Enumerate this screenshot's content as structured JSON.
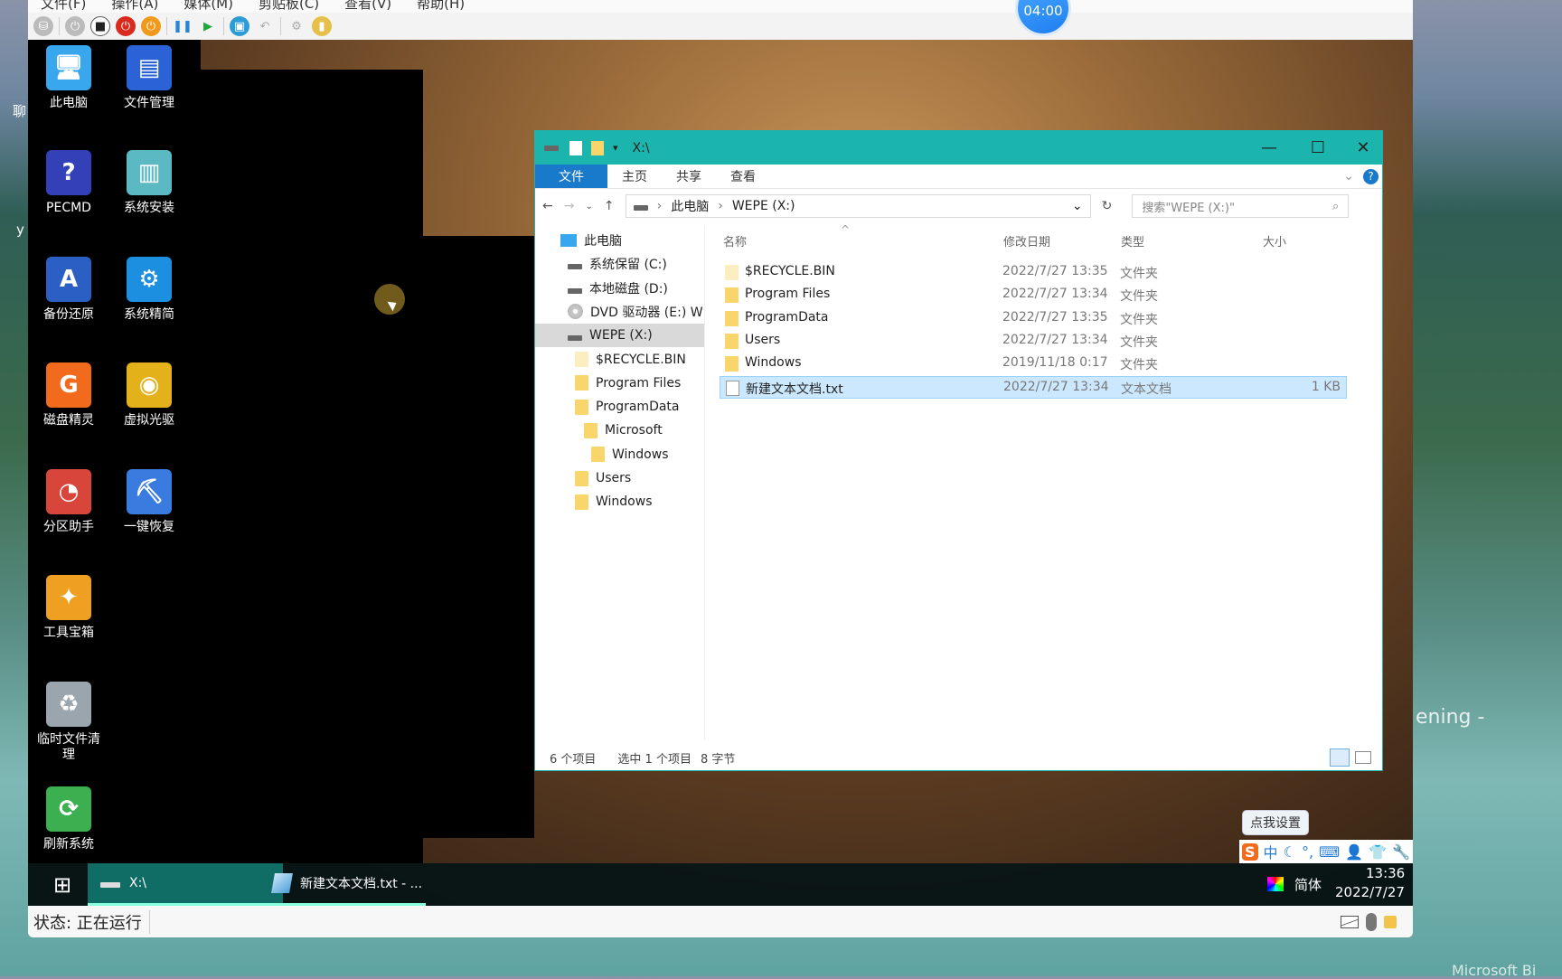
{
  "host": {
    "left_fragments": [
      "聊",
      "y"
    ],
    "right_text": "ening -",
    "watermark": "Microsoft Bi"
  },
  "vm": {
    "menu": [
      "文件(F)",
      "操作(A)",
      "媒体(M)",
      "剪贴板(C)",
      "查看(V)",
      "帮助(H)"
    ],
    "toolbar_icons": [
      "network-icon",
      "power-gray-icon",
      "stop-icon",
      "power-red-icon",
      "power-orange-icon",
      "pause-icon",
      "play-icon",
      "snapshot-icon",
      "undo-icon",
      "settings-icon",
      "folder-share-icon"
    ],
    "timer": "04:00",
    "status": "状态: 正在运行"
  },
  "desktop": {
    "icons": [
      {
        "label": "此电脑",
        "icon": "computer-icon",
        "color": "#39a7ee"
      },
      {
        "label": "文件管理",
        "icon": "floppy-icon",
        "color": "#2b63d6"
      },
      {
        "label": "PECMD",
        "icon": "help-icon",
        "color": "#3440b8"
      },
      {
        "label": "系统安装",
        "icon": "install-icon",
        "color": "#5bb9c4"
      },
      {
        "label": "备份还原",
        "icon": "backup-icon",
        "color": "#2c5fc4"
      },
      {
        "label": "系统精简",
        "icon": "gears-icon",
        "color": "#1d8fe0"
      },
      {
        "label": "磁盘精灵",
        "icon": "diskgenius-icon",
        "color": "#f26a1b"
      },
      {
        "label": "虚拟光驱",
        "icon": "cd-icon",
        "color": "#e3b21a"
      },
      {
        "label": "分区助手",
        "icon": "partition-icon",
        "color": "#d8453a"
      },
      {
        "label": "一键恢复",
        "icon": "restore-icon",
        "color": "#3a7be0"
      },
      {
        "label": "工具宝箱",
        "icon": "toolbox-icon",
        "color": "#f0a020"
      },
      {
        "label": "临时文件清理",
        "icon": "recycle-icon",
        "color": "#9aa5ad"
      },
      {
        "label": "刷新系统",
        "icon": "refresh-icon",
        "color": "#3cb050"
      }
    ]
  },
  "explorer": {
    "title": "X:\\",
    "accent": "#1bb5ad",
    "ribbon_tabs": [
      "文件",
      "主页",
      "共享",
      "查看"
    ],
    "breadcrumb": [
      "此电脑",
      "WEPE (X:)"
    ],
    "search_placeholder": "搜索\"WEPE (X:)\"",
    "nav": [
      {
        "label": "此电脑",
        "type": "pc"
      },
      {
        "label": "系统保留 (C:)",
        "type": "drive"
      },
      {
        "label": "本地磁盘 (D:)",
        "type": "drive"
      },
      {
        "label": "DVD 驱动器 (E:) W",
        "type": "dvd"
      },
      {
        "label": "WEPE (X:)",
        "type": "drive",
        "selected": true
      },
      {
        "label": "$RECYCLE.BIN",
        "type": "folder-pale"
      },
      {
        "label": "Program Files",
        "type": "folder"
      },
      {
        "label": "ProgramData",
        "type": "folder"
      },
      {
        "label": "Microsoft",
        "type": "folder"
      },
      {
        "label": "Windows",
        "type": "folder"
      },
      {
        "label": "Users",
        "type": "folder"
      },
      {
        "label": "Windows",
        "type": "folder"
      }
    ],
    "columns": [
      "名称",
      "修改日期",
      "类型",
      "大小"
    ],
    "files": [
      {
        "name": "$RECYCLE.BIN",
        "date": "2022/7/27 13:35",
        "type": "文件夹",
        "size": "",
        "kind": "folder-pale"
      },
      {
        "name": "Program Files",
        "date": "2022/7/27 13:34",
        "type": "文件夹",
        "size": "",
        "kind": "folder"
      },
      {
        "name": "ProgramData",
        "date": "2022/7/27 13:35",
        "type": "文件夹",
        "size": "",
        "kind": "folder"
      },
      {
        "name": "Users",
        "date": "2022/7/27 13:34",
        "type": "文件夹",
        "size": "",
        "kind": "folder"
      },
      {
        "name": "Windows",
        "date": "2019/11/18 0:17",
        "type": "文件夹",
        "size": "",
        "kind": "folder"
      },
      {
        "name": "新建文本文档.txt",
        "date": "2022/7/27 13:34",
        "type": "文本文档",
        "size": "1 KB",
        "kind": "file",
        "selected": true
      }
    ],
    "status": {
      "count": "6 个项目",
      "selected": "选中 1 个项目",
      "bytes": "8 字节"
    }
  },
  "taskbar": {
    "tasks": [
      {
        "label": "X:\\",
        "active": true
      },
      {
        "label": "新建文本文档.txt - ...",
        "active": false
      }
    ],
    "ime_tip": "点我设置",
    "ime_icons": [
      "sogou-icon",
      "中",
      "moon-icon",
      "punctuation-icon",
      "keyboard-icon",
      "user-icon",
      "skin-icon",
      "wrench-icon"
    ],
    "lang": "简体",
    "time": "13:36",
    "date": "2022/7/27"
  }
}
